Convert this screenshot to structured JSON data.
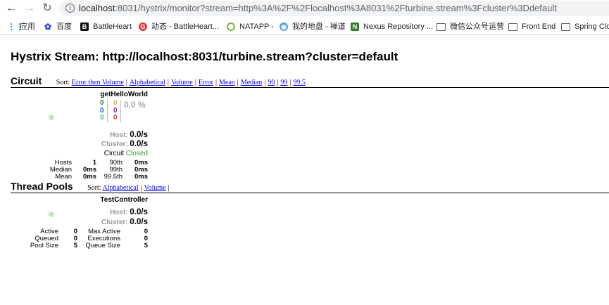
{
  "browser": {
    "back": "←",
    "forward": "→",
    "reload": "↻",
    "info": "i",
    "url_host": "localhost",
    "url_rest": ":8031/hystrix/monitor?stream=http%3A%2F%2Flocalhost%3A8031%2Fturbine.stream%3Fcluster%3Ddefault",
    "bookmarks": [
      {
        "label": "应用",
        "icon": "apps-grid-icon",
        "glyph": "⋮⋮"
      },
      {
        "label": "百度",
        "icon": "baidu-icon",
        "glyph": "✿"
      },
      {
        "label": "BattleHeart",
        "icon": "battleheart-icon",
        "glyph": "B"
      },
      {
        "label": "动态 - BattleHeart...",
        "icon": "google-icon",
        "glyph": "G"
      },
      {
        "label": "NATAPP -",
        "icon": "natapp-icon",
        "glyph": ""
      },
      {
        "label": "我的地盘 - 禅道",
        "icon": "zentao-icon",
        "glyph": "◉"
      },
      {
        "label": "Nexus Repository ...",
        "icon": "nexus-icon",
        "glyph": "N"
      },
      {
        "label": "微信公众号运营",
        "icon": "folder-icon",
        "glyph": ""
      },
      {
        "label": "Front End",
        "icon": "folder-icon",
        "glyph": ""
      },
      {
        "label": "Spring Clo",
        "icon": "folder-icon",
        "glyph": ""
      }
    ]
  },
  "page": {
    "title": "Hystrix Stream: http://localhost:8031/turbine.stream?cluster=default"
  },
  "circuit": {
    "title": "Circuit",
    "sort_label": "Sort:",
    "sort_links": [
      "Error then Volume",
      "Alphabetical",
      "Volume",
      "Error",
      "Mean",
      "Median",
      "90",
      "99",
      "99.5"
    ],
    "monitor": {
      "name": "getHelloWorld",
      "counts_left": [
        "0",
        "0",
        "0"
      ],
      "counts_right": [
        "0",
        "0",
        "0"
      ],
      "error_pct": "0.0 %",
      "host_label": "Host:",
      "host_rate": "0.0/s",
      "cluster_label": "Cluster:",
      "cluster_rate": "0.0/s",
      "circuit_label": "Circuit",
      "circuit_status": "Closed",
      "stats": [
        {
          "label": "Hosts",
          "value": "1",
          "label2": "90th",
          "value2": "0ms"
        },
        {
          "label": "Median",
          "value": "0ms",
          "label2": "99th",
          "value2": "0ms"
        },
        {
          "label": "Mean",
          "value": "0ms",
          "label2": "99.5th",
          "value2": "0ms"
        }
      ]
    }
  },
  "threadpools": {
    "title": "Thread Pools",
    "sort_label": "Sort:",
    "sort_links": [
      "Alphabetical",
      "Volume"
    ],
    "trailing_sep": "|",
    "monitor": {
      "name": "TestController",
      "host_label": "Host:",
      "host_rate": "0.0/s",
      "cluster_label": "Cluster:",
      "cluster_rate": "0.0/s",
      "stats": [
        {
          "label": "Active",
          "value": "0",
          "label2": "Max Active",
          "value2": "0"
        },
        {
          "label": "Queued",
          "value": "0",
          "label2": "Executions",
          "value2": "0"
        },
        {
          "label": "Pool Size",
          "value": "5",
          "label2": "Queue Size",
          "value2": "5"
        }
      ]
    }
  }
}
